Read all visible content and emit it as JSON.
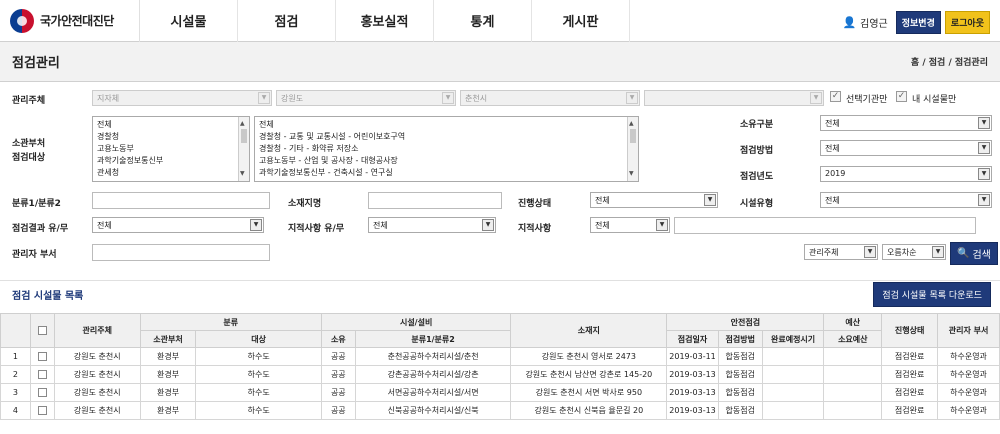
{
  "header": {
    "logo_text": "국가안전대진단",
    "nav": [
      "시설물",
      "점검",
      "홍보실적",
      "통계",
      "게시판"
    ],
    "user_name": "김영근",
    "btn_info": "정보변경",
    "btn_logout": "로그아웃"
  },
  "page": {
    "title": "점검관리",
    "breadcrumb": "홈 / 점검 / 점검관리"
  },
  "filters": {
    "mgmt_label": "관리주체",
    "mgmt_sel": [
      "지자체",
      "강원도",
      "춘천시",
      ""
    ],
    "chk_selected": "선택기관만",
    "chk_mine": "내 시설물만",
    "dept_label1": "소관부처",
    "dept_label2": "점검대상",
    "dept_list": [
      "전체",
      "경찰청",
      "고용노동부",
      "과학기술정보통신부",
      "관세청"
    ],
    "target_list": [
      "전체",
      "경찰청 - 교통 및 교통시설 - 어린이보호구역",
      "경찰청 - 기타 - 화약류 저장소",
      "고용노동부 - 산업 및 공사장 - 대형공사장",
      "과학기술정보통신부 - 건축시설 - 연구실"
    ],
    "own_label": "소유구분",
    "own_val": "전체",
    "method_label": "점검방법",
    "method_val": "전체",
    "year_label": "점검년도",
    "year_val": "2019",
    "cat_label": "분류1/분류2",
    "loc_label": "소재지명",
    "status_label": "진행상태",
    "status_val": "전체",
    "type_label": "시설유형",
    "type_val": "전체",
    "result_label": "점검결과 유/무",
    "result_val": "전체",
    "issue_label": "지적사항 유/무",
    "issue_val": "전체",
    "issue_detail_label": "지적사항",
    "issue_detail_val": "전체",
    "mgr_label": "관리자 부서",
    "sort1": "관리주체",
    "sort2": "오름차순",
    "search_btn": "검색"
  },
  "list": {
    "title": "점검 시설물 목록",
    "download_btn": "점검 시설물 목록 다운로드",
    "head": {
      "mgmt": "관리주체",
      "cat": "분류",
      "cat_dept": "소관부처",
      "cat_target": "대상",
      "fac": "시설/설비",
      "fac_own": "소유",
      "fac_cat": "분류1/분류2",
      "addr": "소재지",
      "safety": "안전점검",
      "date": "점검일자",
      "method": "점검방법",
      "plan": "완료예정시기",
      "budget": "예산",
      "budget_need": "소요예산",
      "status": "진행상태",
      "mgr": "관리자 부서"
    },
    "rows": [
      {
        "no": "1",
        "mgmt": "강원도 춘천시",
        "dept": "환경부",
        "target": "하수도",
        "own": "공공",
        "cat": "춘천공공하수처리시설/춘천",
        "addr": "강원도 춘천시 영서로 2473",
        "date": "2019-03-11",
        "method": "합동점검",
        "plan": "",
        "budget": "",
        "status": "점검완료",
        "mgr": "하수운영과"
      },
      {
        "no": "2",
        "mgmt": "강원도 춘천시",
        "dept": "환경부",
        "target": "하수도",
        "own": "공공",
        "cat": "강촌공공하수처리시설/강촌",
        "addr": "강원도 춘천시 남산면 강촌로 145-20",
        "date": "2019-03-13",
        "method": "합동점검",
        "plan": "",
        "budget": "",
        "status": "점검완료",
        "mgr": "하수운영과"
      },
      {
        "no": "3",
        "mgmt": "강원도 춘천시",
        "dept": "환경부",
        "target": "하수도",
        "own": "공공",
        "cat": "서면공공하수처리시설/서면",
        "addr": "강원도 춘천시 서면 박사로 950",
        "date": "2019-03-13",
        "method": "합동점검",
        "plan": "",
        "budget": "",
        "status": "점검완료",
        "mgr": "하수운영과"
      },
      {
        "no": "4",
        "mgmt": "강원도 춘천시",
        "dept": "환경부",
        "target": "하수도",
        "own": "공공",
        "cat": "신북공공하수처리시설/신북",
        "addr": "강원도 춘천시 신북읍 율문길 20",
        "date": "2019-03-13",
        "method": "합동점검",
        "plan": "",
        "budget": "",
        "status": "점검완료",
        "mgr": "하수운영과"
      }
    ]
  }
}
